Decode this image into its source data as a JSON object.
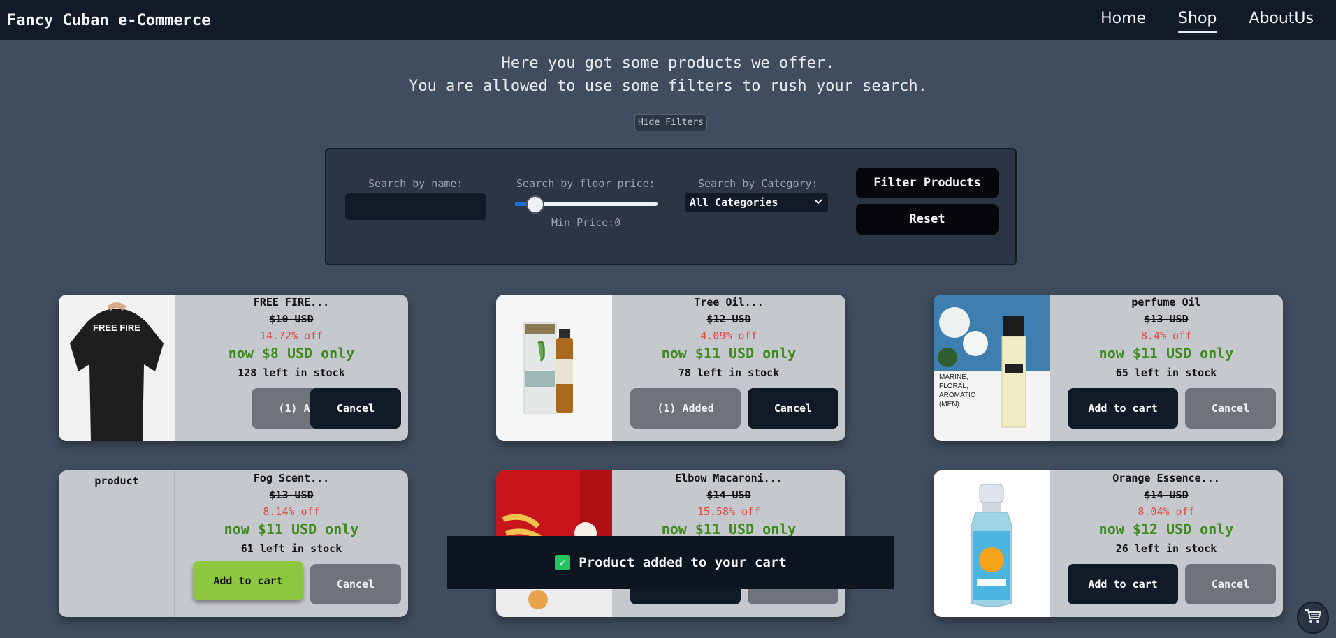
{
  "nav": {
    "brand": "Fancy Cuban e-Commerce",
    "links": [
      {
        "label": "Home"
      },
      {
        "label": "Shop"
      },
      {
        "label": "AboutUs"
      }
    ]
  },
  "intro": {
    "line1": "Here you got some products we offer.",
    "line2": "You are allowed to use some filters to rush your search."
  },
  "filters": {
    "toggle_label": "Hide Filters",
    "name_label": "Search by name:",
    "name_value": "",
    "price_label": "Search by floor price:",
    "min_price_text": "Min Price:0",
    "category_label": "Search by Category:",
    "category_selected": "All Categories",
    "filter_button": "Filter Products",
    "reset_button": "Reset"
  },
  "products": [
    {
      "name": "FREE FIRE...",
      "old_price": "$10 USD",
      "off": "14.72% off",
      "now": "now $8 USD only",
      "stock": "128 left in stock",
      "add_label": "(1) Added",
      "cancel_label": "Cancel",
      "image_caption": ""
    },
    {
      "name": "Tree Oil...",
      "old_price": "$12 USD",
      "off": "4.09% off",
      "now": "now $11 USD only",
      "stock": "78 left in stock",
      "add_label": "(1) Added",
      "cancel_label": "Cancel",
      "image_caption": ""
    },
    {
      "name": "perfume Oil",
      "old_price": "$13 USD",
      "off": "8.4% off",
      "now": "now $11 USD only",
      "stock": "65 left in stock",
      "add_label": "Add to cart",
      "cancel_label": "Cancel",
      "image_caption": "MARINE, FLORAL, AROMATIC (MEN)"
    },
    {
      "name": "Fog Scent...",
      "old_price": "$13 USD",
      "off": "8.14% off",
      "now": "now $11 USD only",
      "stock": "61 left in stock",
      "add_label": "Add to cart",
      "cancel_label": "Cancel",
      "image_caption": "product"
    },
    {
      "name": "Elbow Macaroni...",
      "old_price": "$14 USD",
      "off": "15.58% off",
      "now": "now $11 USD only",
      "stock": "",
      "add_label": "",
      "cancel_label": "",
      "image_caption": ""
    },
    {
      "name": "Orange Essence...",
      "old_price": "$14 USD",
      "off": "8.04% off",
      "now": "now $12 USD only",
      "stock": "26 left in stock",
      "add_label": "Add to cart",
      "cancel_label": "Cancel",
      "image_caption": ""
    }
  ],
  "toast": {
    "message": "Product added to your cart"
  },
  "icons": {
    "check": "check-icon",
    "cart": "cart-icon",
    "chevron": "chevron-down-icon"
  }
}
